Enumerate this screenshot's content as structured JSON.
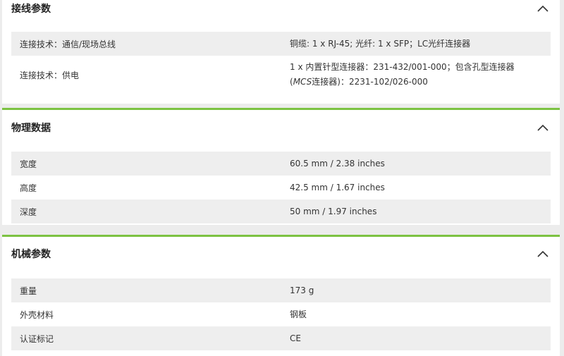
{
  "sections": [
    {
      "title": "接线参数",
      "rows": [
        {
          "label": "连接技术：通信/现场总线",
          "value": "铜缆: 1 x RJ-45; 光纤: 1 x SFP；LC光纤连接器"
        },
        {
          "label": "连接技术：供电",
          "value_line1": "1 x 内置针型连接器：231-432/001-000；包含孔型连接器",
          "value_line2_prefix": "(",
          "value_line2_italic": "MCS",
          "value_line2_rest": "连接器)：2231-102/026-000"
        }
      ]
    },
    {
      "title": "物理数据",
      "rows": [
        {
          "label": "宽度",
          "value": "60.5 mm / 2.38 inches"
        },
        {
          "label": "高度",
          "value": "42.5 mm / 1.67 inches"
        },
        {
          "label": "深度",
          "value": "50 mm / 1.97 inches"
        }
      ]
    },
    {
      "title": "机械参数",
      "rows": [
        {
          "label": "重量",
          "value": "173 g"
        },
        {
          "label": "外壳材料",
          "value": "钢板"
        },
        {
          "label": "认证标记",
          "value": "CE"
        }
      ]
    }
  ],
  "icons": {
    "collapse": "chevron-up-icon"
  },
  "colors": {
    "accent": "#7cc242",
    "row_shade": "#eeeeee",
    "background": "#ececec"
  }
}
